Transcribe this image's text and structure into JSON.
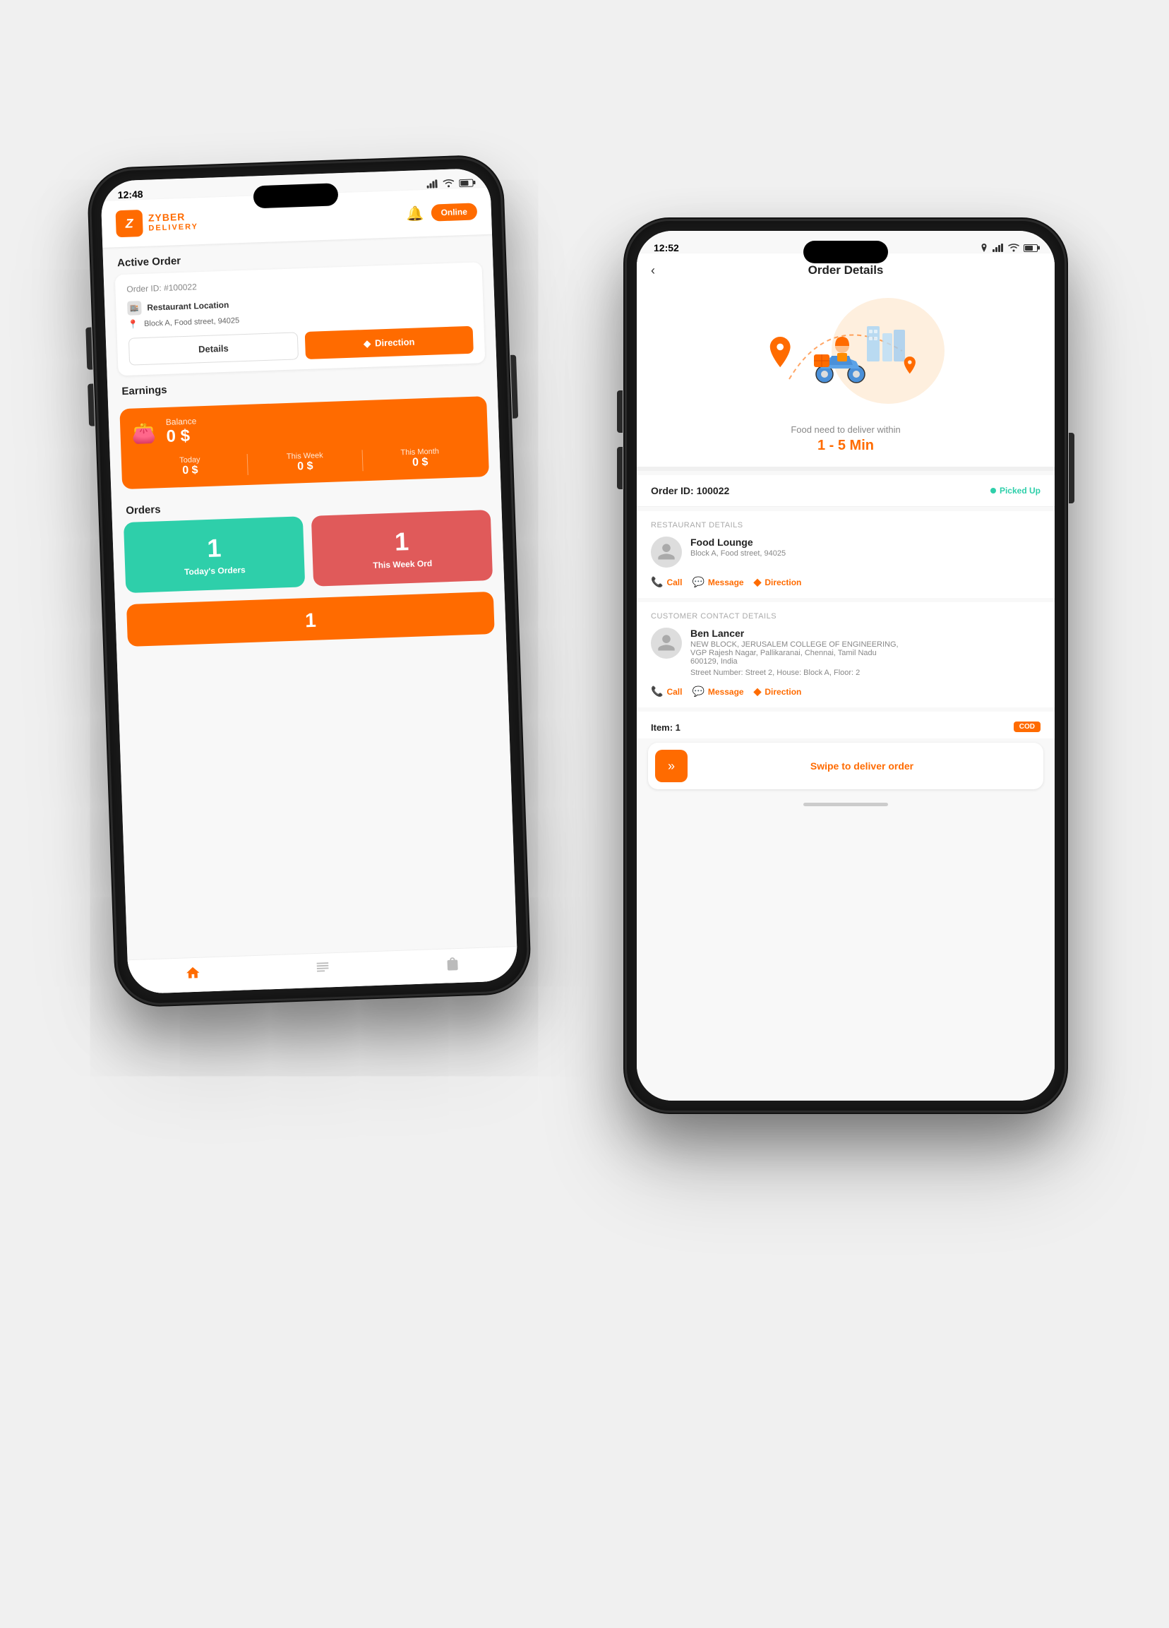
{
  "scene": {
    "background": "#f0f0f0"
  },
  "phone1": {
    "status_time": "12:48",
    "header": {
      "brand_name": "ZYBER",
      "brand_sub": "DELIVERY",
      "logo_letter": "Z",
      "online_label": "Online"
    },
    "active_order": {
      "section_title": "Active Order",
      "order_id": "Order ID: #100022",
      "restaurant_label": "Restaurant Location",
      "address": "Block A, Food street, 94025",
      "btn_details": "Details",
      "btn_direction": "Direction"
    },
    "earnings": {
      "section_title": "Earnings",
      "balance_label": "Balance",
      "balance_value": "0 $",
      "today_label": "Today",
      "today_value": "0 $",
      "week_label": "This Week",
      "week_value": "0 $",
      "month_label": "This Month",
      "month_value": "0 $"
    },
    "orders": {
      "section_title": "Orders",
      "todays_count": "1",
      "todays_label": "Today's Orders",
      "thisweek_count": "1",
      "thisweek_label": "This Week Ord"
    },
    "bottom_nav": {
      "home": "🏠",
      "list": "☰",
      "bag": "🛍"
    }
  },
  "phone2": {
    "status_time": "12:52",
    "header_title": "Order Details",
    "delivery_time_label": "Food need to deliver within",
    "delivery_time_value": "1 - 5 Min",
    "order_id": "Order ID: 100022",
    "status": "Picked Up",
    "restaurant": {
      "section_label": "Restaurant Details",
      "name": "Food Lounge",
      "address": "Block A, Food street, 94025",
      "btn_call": "Call",
      "btn_message": "Message",
      "btn_direction": "Direction"
    },
    "customer": {
      "section_label": "Customer Contact Details",
      "name": "Ben Lancer",
      "address_line1": "NEW BLOCK, JERUSALEM COLLEGE OF ENGINEERING,",
      "address_line2": "VGP Rajesh Nagar, Pallikaranai, Chennai, Tamil Nadu",
      "address_line3": "600129, India",
      "street": "Street Number: Street 2, House: Block A, Floor: 2",
      "btn_call": "Call",
      "btn_message": "Message",
      "btn_direction": "Direction"
    },
    "item_label": "Item: 1",
    "cod_badge": "COD",
    "swipe_text": "Swipe to deliver order"
  }
}
